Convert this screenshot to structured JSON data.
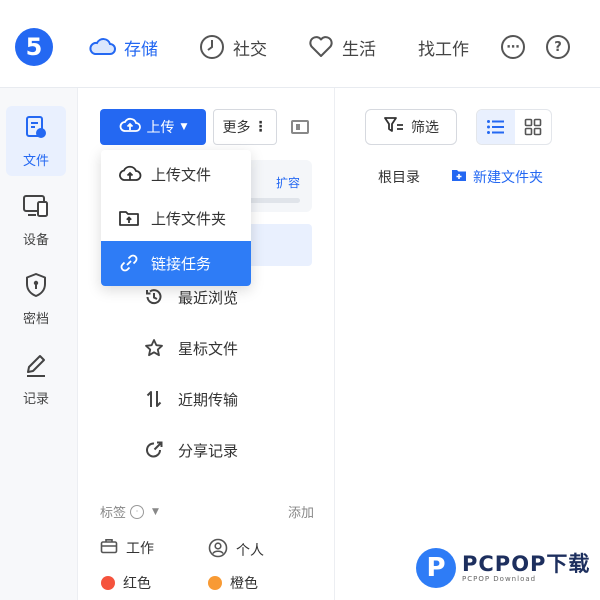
{
  "logo": {
    "glyph": "5"
  },
  "topnav": {
    "items": [
      {
        "label": "存储",
        "icon": "cloud-icon"
      },
      {
        "label": "社交",
        "icon": "clock-icon"
      },
      {
        "label": "生活",
        "icon": "heart-icon"
      },
      {
        "label": "找工作",
        "icon": ""
      }
    ],
    "accent": "#2468f2"
  },
  "rail": {
    "items": [
      {
        "label": "文件",
        "icon": "files-icon"
      },
      {
        "label": "设备",
        "icon": "devices-icon"
      },
      {
        "label": "密档",
        "icon": "shield-lock-icon"
      },
      {
        "label": "记录",
        "icon": "pen-icon"
      }
    ]
  },
  "toolbar": {
    "upload_label": "上传",
    "more_label": "更多"
  },
  "storage": {
    "expand_label": "扩容"
  },
  "upload_menu": {
    "items": [
      {
        "label": "上传文件",
        "icon": "upload-cloud-icon"
      },
      {
        "label": "上传文件夹",
        "icon": "upload-folder-icon"
      },
      {
        "label": "链接任务",
        "icon": "link-icon"
      }
    ]
  },
  "sidebar": {
    "items": [
      {
        "label": "最近浏览",
        "icon": "history-icon"
      },
      {
        "label": "星标文件",
        "icon": "star-icon"
      },
      {
        "label": "近期传输",
        "icon": "transfer-icon"
      },
      {
        "label": "分享记录",
        "icon": "share-icon"
      }
    ]
  },
  "tags": {
    "title": "标签",
    "add_label": "添加",
    "items": [
      {
        "label": "工作",
        "icon": "briefcase-icon"
      },
      {
        "label": "个人",
        "icon": "person-icon"
      },
      {
        "label": "红色",
        "color": "#f5533d"
      },
      {
        "label": "橙色",
        "color": "#f89a34"
      }
    ]
  },
  "main": {
    "filter_label": "筛选",
    "breadcrumb_root": "根目录",
    "new_folder_label": "新建文件夹"
  },
  "watermark": {
    "main": "PCPOP下载",
    "sub": "PCPOP Download",
    "glyph": "P"
  }
}
